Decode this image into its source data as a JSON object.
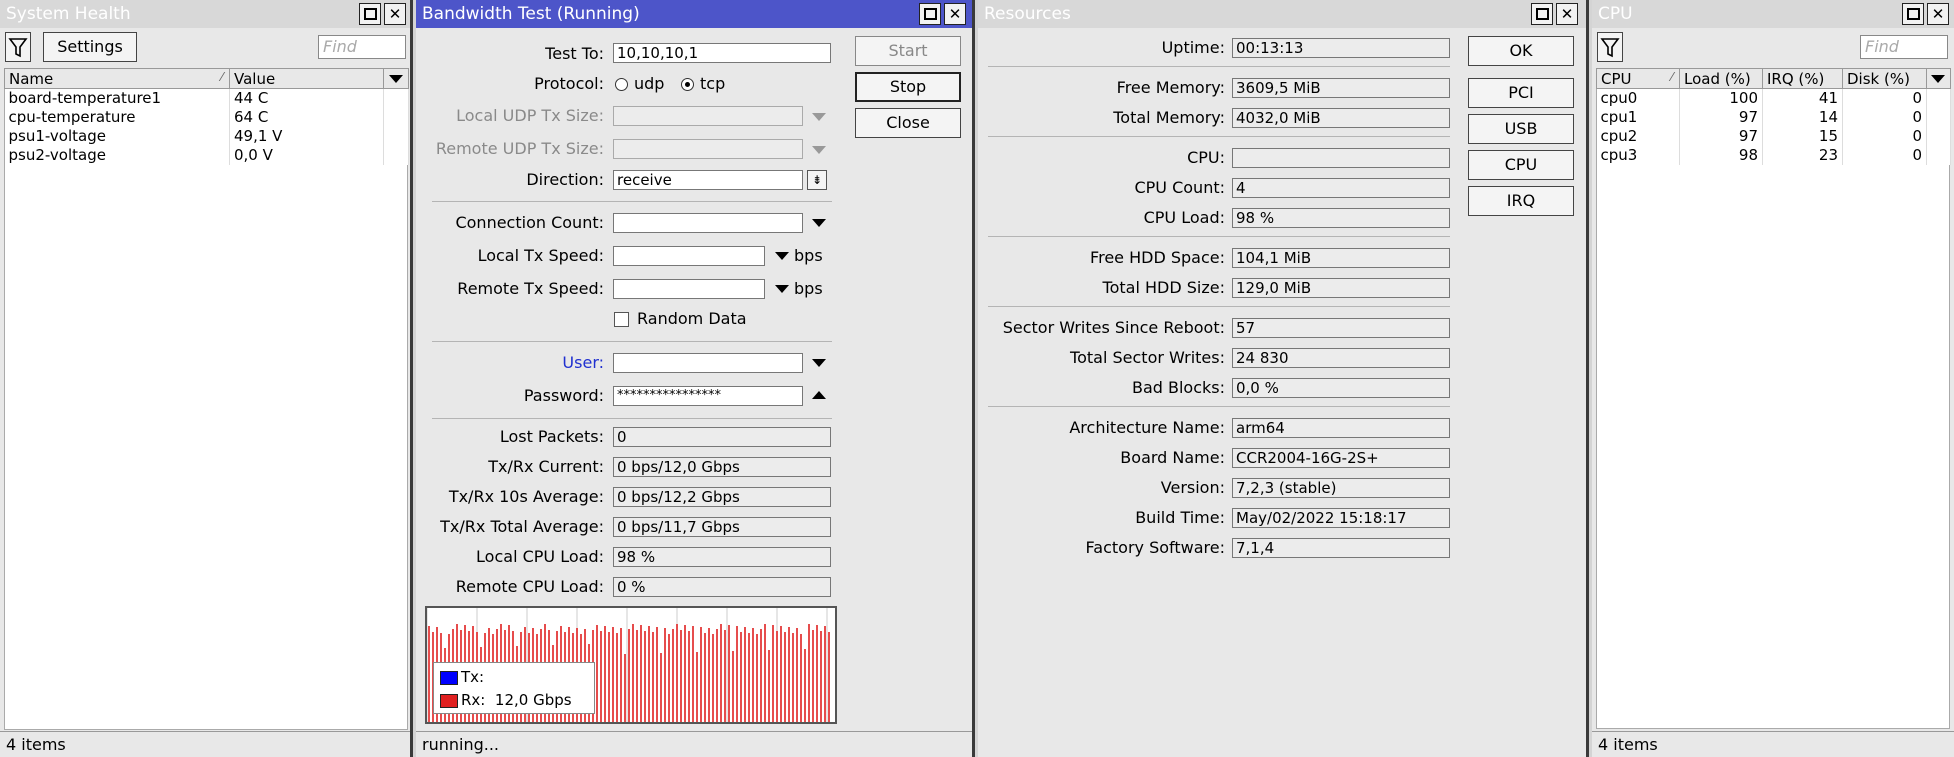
{
  "system_health": {
    "title": "System Health",
    "settings_label": "Settings",
    "find_placeholder": "Find",
    "columns": [
      "Name",
      "Value"
    ],
    "rows": [
      {
        "name": "board-temperature1",
        "value": "44 C"
      },
      {
        "name": "cpu-temperature",
        "value": "64 C"
      },
      {
        "name": "psu1-voltage",
        "value": "49,1 V"
      },
      {
        "name": "psu2-voltage",
        "value": "0,0 V"
      }
    ],
    "status": "4 items"
  },
  "bandwidth_test": {
    "title": "Bandwidth Test (Running)",
    "buttons": {
      "start": "Start",
      "stop": "Stop",
      "close": "Close"
    },
    "labels": {
      "test_to": "Test To:",
      "protocol": "Protocol:",
      "local_udp_tx_size": "Local UDP Tx Size:",
      "remote_udp_tx_size": "Remote UDP Tx Size:",
      "direction": "Direction:",
      "connection_count": "Connection Count:",
      "local_tx_speed": "Local Tx Speed:",
      "remote_tx_speed": "Remote Tx Speed:",
      "random_data": "Random Data",
      "user": "User:",
      "password": "Password:",
      "lost_packets": "Lost Packets:",
      "txrx_current": "Tx/Rx Current:",
      "txrx_10s_avg": "Tx/Rx 10s Average:",
      "txrx_total_avg": "Tx/Rx Total Average:",
      "local_cpu_load": "Local CPU Load:",
      "remote_cpu_load": "Remote CPU Load:"
    },
    "values": {
      "test_to": "10,10,10,1",
      "protocol_options": [
        "udp",
        "tcp"
      ],
      "protocol_selected": "tcp",
      "direction": "receive",
      "unit_bps": "bps",
      "password": "****************",
      "lost_packets": "0",
      "txrx_current": "0 bps/12,0 Gbps",
      "txrx_10s_avg": "0 bps/12,2 Gbps",
      "txrx_total_avg": "0 bps/11,7 Gbps",
      "local_cpu_load": "98 %",
      "remote_cpu_load": "0 %"
    },
    "legend": {
      "tx_label": "Tx:",
      "tx_value": "",
      "rx_label": "Rx:",
      "rx_value": "12,0 Gbps",
      "tx_color": "#0000ff",
      "rx_color": "#e02020"
    },
    "status": "running..."
  },
  "resources": {
    "title": "Resources",
    "buttons": {
      "ok": "OK",
      "pci": "PCI",
      "usb": "USB",
      "cpu": "CPU",
      "irq": "IRQ"
    },
    "fields": [
      {
        "label": "Uptime:",
        "value": "00:13:13"
      },
      {
        "label": "Free Memory:",
        "value": "3609,5 MiB"
      },
      {
        "label": "Total Memory:",
        "value": "4032,0 MiB"
      },
      {
        "label": "CPU:",
        "value": ""
      },
      {
        "label": "CPU Count:",
        "value": "4"
      },
      {
        "label": "CPU Load:",
        "value": "98 %"
      },
      {
        "label": "Free HDD Space:",
        "value": "104,1 MiB"
      },
      {
        "label": "Total HDD Size:",
        "value": "129,0 MiB"
      },
      {
        "label": "Sector Writes Since Reboot:",
        "value": "57"
      },
      {
        "label": "Total Sector Writes:",
        "value": "24 830"
      },
      {
        "label": "Bad Blocks:",
        "value": "0,0 %"
      },
      {
        "label": "Architecture Name:",
        "value": "arm64"
      },
      {
        "label": "Board Name:",
        "value": "CCR2004-16G-2S+"
      },
      {
        "label": "Version:",
        "value": "7,2,3 (stable)"
      },
      {
        "label": "Build Time:",
        "value": "May/02/2022 15:18:17"
      },
      {
        "label": "Factory Software:",
        "value": "7,1,4"
      }
    ]
  },
  "cpu": {
    "title": "CPU",
    "find_placeholder": "Find",
    "columns": [
      "CPU",
      "Load (%)",
      "IRQ (%)",
      "Disk (%)"
    ],
    "rows": [
      {
        "cpu": "cpu0",
        "load": "100",
        "irq": "41",
        "disk": "0"
      },
      {
        "cpu": "cpu1",
        "load": "97",
        "irq": "14",
        "disk": "0"
      },
      {
        "cpu": "cpu2",
        "load": "97",
        "irq": "15",
        "disk": "0"
      },
      {
        "cpu": "cpu3",
        "load": "98",
        "irq": "23",
        "disk": "0"
      }
    ],
    "status": "4 items"
  }
}
